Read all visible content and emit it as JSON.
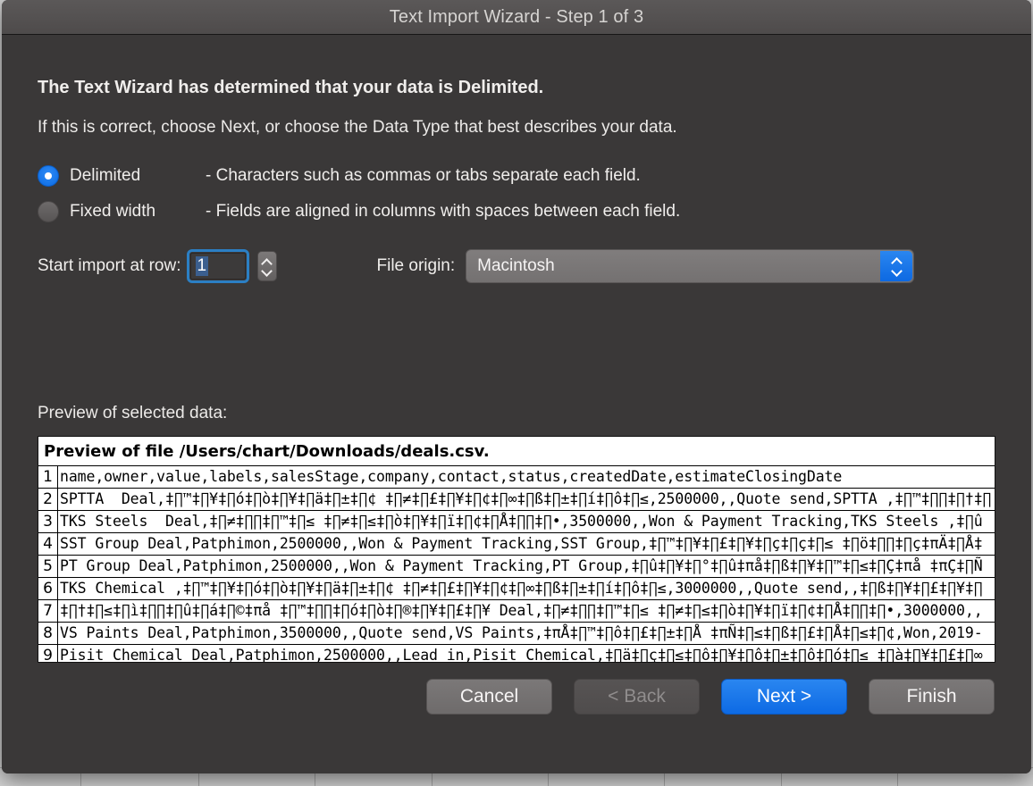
{
  "window": {
    "title": "Text Import Wizard - Step 1 of 3"
  },
  "content": {
    "headline": "The Text Wizard has determined that your data is Delimited.",
    "subline": "If this is correct, choose Next, or choose the Data Type that best describes your data."
  },
  "data_type": {
    "options": [
      {
        "label": "Delimited",
        "description": "- Characters such as commas or tabs separate each field.",
        "selected": true
      },
      {
        "label": "Fixed width",
        "description": "- Fields are aligned in columns with spaces between each field.",
        "selected": false
      }
    ]
  },
  "start_row": {
    "label": "Start import at row:",
    "value": "1"
  },
  "file_origin": {
    "label": "File origin:",
    "value": "Macintosh"
  },
  "preview": {
    "section_label": "Preview of selected data:",
    "file_header": "Preview of file /Users/chart/Downloads/deals.csv.",
    "rows": [
      {
        "num": "1",
        "text": "name,owner,value,labels,salesStage,company,contact,status,createdDate,estimateClosingDate"
      },
      {
        "num": "2",
        "text": "SPTTA  Deal,‡∏™‡∏¥‡∏ó‡∏ò‡∏¥‡∏ä‡∏±‡∏¢ ‡∏≠‡∏£‡∏¥‡∏¢‡∏∞‡∏ß‡∏±‡∏í‡∏ô‡∏≤,2500000,,Quote send,SPTTA ,‡∏™‡∏∏‡∏†‡∏"
      },
      {
        "num": "3",
        "text": "TKS Steels  Deal,‡∏≠‡∏∏‡∏™‡∏≤ ‡∏≠‡∏≤‡∏ò‡∏¥‡∏ï‡∏¢‡∏Å‡∏∏‡∏•,3500000,,Won & Payment Tracking,TKS Steels ,‡∏û"
      },
      {
        "num": "4",
        "text": "SST Group Deal,Patphimon,2500000,,Won & Payment Tracking,SST Group,‡∏™‡∏¥‡∏£‡∏¥‡∏ç‡∏ç‡∏≤ ‡∏ö‡∏∏‡∏ç‡πÄ‡∏Å‡"
      },
      {
        "num": "5",
        "text": "PT Group Deal,Patphimon,2500000,,Won & Payment Tracking,PT Group,‡∏û‡∏¥‡∏°‡∏û‡πå‡∏ß‡∏¥‡∏™‡∏≤‡∏Ç‡πå ‡πÇ‡∏Ñ"
      },
      {
        "num": "6",
        "text": "TKS Chemical ,‡∏™‡∏¥‡∏ó‡∏ò‡∏¥‡∏ä‡∏±‡∏¢ ‡∏≠‡∏£‡∏¥‡∏¢‡∏∞‡∏ß‡∏±‡∏í‡∏ô‡∏≤,3000000,,Quote send,,‡∏ß‡∏¥‡∏£‡∏¥‡∏"
      },
      {
        "num": "7",
        "text": "‡∏†‡∏≤‡∏ì‡∏∏‡∏û‡∏á‡∏©‡πå ‡∏™‡∏∏‡∏ó‡∏ò‡∏®‡∏¥‡∏£‡∏¥ Deal,‡∏≠‡∏∏‡∏™‡∏≤ ‡∏≠‡∏≤‡∏ò‡∏¥‡∏ï‡∏¢‡∏Å‡∏∏‡∏•,3000000,,"
      },
      {
        "num": "8",
        "text": "VS Paints Deal,Patphimon,3500000,,Quote send,VS Paints,‡πÅ‡∏™‡∏ô‡∏£‡∏±‡∏Å ‡πÑ‡∏≤‡∏ß‡∏£‡∏Å‡∏≤‡∏¢,Won,2019-"
      },
      {
        "num": "9",
        "text": "Pisit Chemical Deal,Patphimon,2500000,,Lead in,Pisit Chemical,‡∏ä‡∏ç‡∏≤‡∏ô‡∏¥‡∏ô‡∏±‡∏ô‡∏ó‡∏≤ ‡∏à‡∏¥‡∏£‡∏∞"
      }
    ]
  },
  "buttons": [
    {
      "label": "Cancel",
      "style": "normal"
    },
    {
      "label": "< Back",
      "style": "disabled"
    },
    {
      "label": "Next >",
      "style": "primary"
    },
    {
      "label": "Finish",
      "style": "normal"
    }
  ]
}
